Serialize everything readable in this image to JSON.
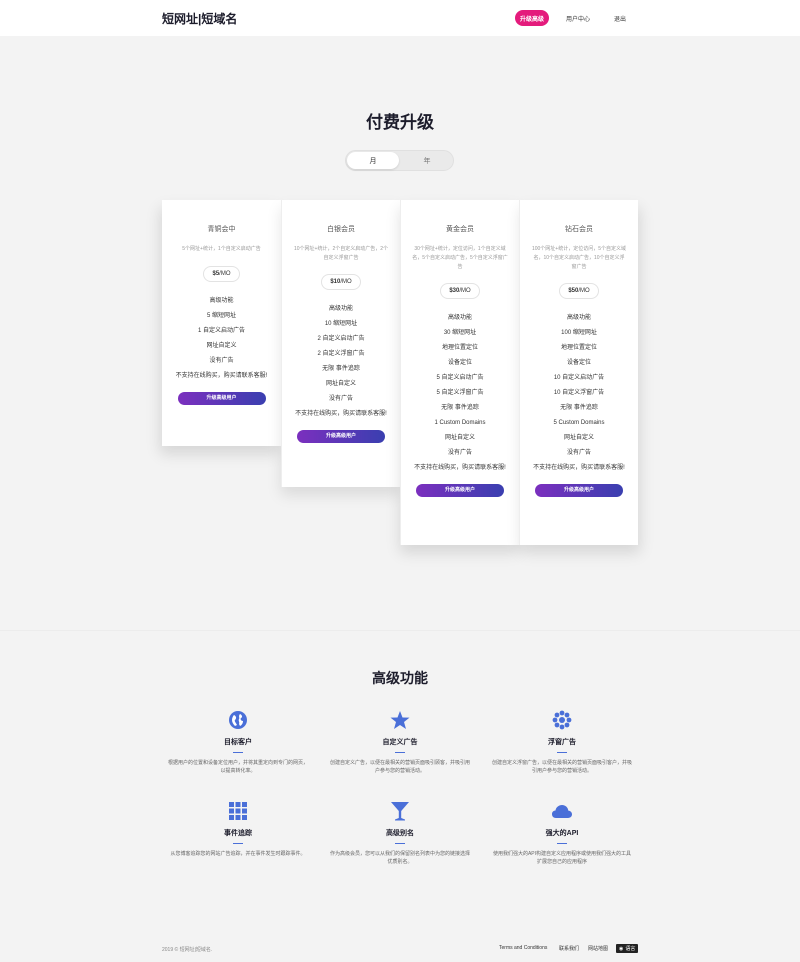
{
  "header": {
    "logo": "短网址|短域名",
    "nav": {
      "upgrade": "升级高级",
      "user_center": "用户中心",
      "logout": "退出"
    }
  },
  "pricing": {
    "title": "付费升级",
    "toggle": {
      "month": "月",
      "year": "年",
      "selected": "月"
    },
    "plans": [
      {
        "name": "青铜会中",
        "desc": "5个网址+统计，1个自定义启动广告",
        "price": "$5",
        "period": "/MO",
        "features": [
          "高级功能",
          "5 缩短网址",
          "1 自定义启动广告",
          "网址自定义",
          "没有广告",
          "不支持在线购买，购买请联系客服!"
        ],
        "button": "升级高级用户"
      },
      {
        "name": "白银会员",
        "desc": "10个网址+统计，2个自定义启动广告，2个自定义浮窗广告",
        "price": "$10",
        "period": "/MO",
        "features": [
          "高级功能",
          "10 缩短网址",
          "2 自定义启动广告",
          "2 自定义浮窗广告",
          "无限 事件追踪",
          "网址自定义",
          "没有广告",
          "不支持在线购买，购买请联系客服!"
        ],
        "button": "升级高级用户"
      },
      {
        "name": "黄金会员",
        "desc": "30个网址+统计，定位访问，1个自定义域名，5个自定义启动广告，5个自定义浮窗广告",
        "price": "$30",
        "period": "/MO",
        "features": [
          "高级功能",
          "30 缩短网址",
          "地理位置定位",
          "设备定位",
          "5 自定义启动广告",
          "5 自定义浮窗广告",
          "无限 事件追踪",
          "1 Custom Domains",
          "网址自定义",
          "没有广告",
          "不支持在线购买，购买请联系客服!"
        ],
        "button": "升级高级用户"
      },
      {
        "name": "钻石会员",
        "desc": "100个网址+统计，定位访问，5个自定义域名，10个自定义启动广告，10个自定义浮窗广告",
        "price": "$50",
        "period": "/MO",
        "features": [
          "高级功能",
          "100 缩短网址",
          "地理位置定位",
          "设备定位",
          "10 自定义启动广告",
          "10 自定义浮窗广告",
          "无限 事件追踪",
          "5 Custom Domains",
          "网址自定义",
          "没有广告",
          "不支持在线购买，购买请联系客服!"
        ],
        "button": "升级高级用户"
      }
    ]
  },
  "features": {
    "title": "高级功能",
    "accent": "#4a6fd8",
    "items": [
      {
        "icon": "globe-icon",
        "name": "目标客户",
        "desc": "根据用户的位置和设备定位用户，并将其重定向到专门的网页，以提高转化率。"
      },
      {
        "icon": "star-icon",
        "name": "自定义广告",
        "desc": "创建自定义广告，以便在最相关的营销页面吸引顾客，并吸引用户参与您的营销活动。"
      },
      {
        "icon": "asterisk-icon",
        "name": "浮窗广告",
        "desc": "创建自定义浮窗广告，以便在最相关的营销页面吸引客户，并吸引用户参与您的营销活动。"
      },
      {
        "icon": "grid-icon",
        "name": "事件追踪",
        "desc": "从您博客追踪您的网站广告追踪，并在事件发生时跟踪事件。"
      },
      {
        "icon": "cocktail-icon",
        "name": "高级别名",
        "desc": "作为高级会员，您可以从我们的保留别名列表中为您的链接选择优质别名。"
      },
      {
        "icon": "cloud-icon",
        "name": "强大的API",
        "desc": "使用我们强大的API构建自定义应用程序或使用我们强大的工具扩展您自己的应用程序"
      }
    ]
  },
  "footer": {
    "copyright": "2019 © 短网址|短域名.",
    "links": {
      "terms": "Terms and Conditions",
      "contact": "联系我们",
      "sitemap": "网站地图",
      "language": "语言"
    }
  }
}
